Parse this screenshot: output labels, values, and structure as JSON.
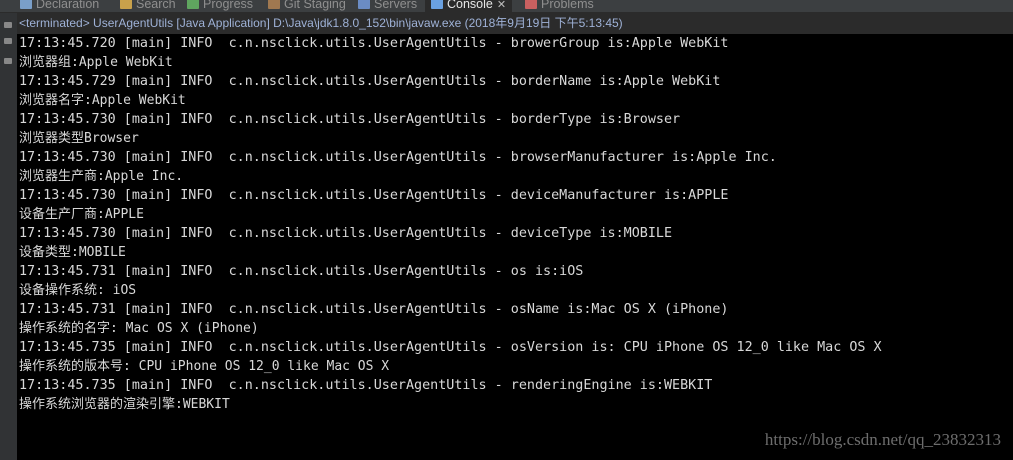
{
  "tabs": [
    {
      "name": "tab-declaration",
      "label": "Declaration",
      "icon": "declaration-icon",
      "color": "#7a9fc9"
    },
    {
      "name": "tab-search",
      "label": "Search",
      "icon": "search-icon",
      "color": "#c8a14b"
    },
    {
      "name": "tab-progress",
      "label": "Progress",
      "icon": "progress-icon",
      "color": "#5fa55f"
    },
    {
      "name": "tab-git-staging",
      "label": "Git Staging",
      "icon": "git-icon",
      "color": "#a07850"
    },
    {
      "name": "tab-servers",
      "label": "Servers",
      "icon": "servers-icon",
      "color": "#6b8cc4"
    },
    {
      "name": "tab-console",
      "label": "Console",
      "icon": "console-icon",
      "color": "#6aa0e0"
    },
    {
      "name": "tab-problems",
      "label": "Problems",
      "icon": "problems-icon",
      "color": "#c96060"
    }
  ],
  "console_tab_close": "✕",
  "status": "<terminated> UserAgentUtils [Java Application] D:\\Java\\jdk1.8.0_152\\bin\\javaw.exe (2018年9月19日 下午5:13:45)",
  "lines": [
    {
      "kind": "log",
      "text": "17:13:45.720 [main] INFO  c.n.nsclick.utils.UserAgentUtils - browerGroup is:Apple WebKit"
    },
    {
      "kind": "out",
      "text": "浏览器组:Apple WebKit"
    },
    {
      "kind": "log",
      "text": "17:13:45.729 [main] INFO  c.n.nsclick.utils.UserAgentUtils - borderName is:Apple WebKit"
    },
    {
      "kind": "out",
      "text": "浏览器名字:Apple WebKit"
    },
    {
      "kind": "log",
      "text": "17:13:45.730 [main] INFO  c.n.nsclick.utils.UserAgentUtils - borderType is:Browser"
    },
    {
      "kind": "out",
      "text": "浏览器类型Browser"
    },
    {
      "kind": "log",
      "text": "17:13:45.730 [main] INFO  c.n.nsclick.utils.UserAgentUtils - browserManufacturer is:Apple Inc."
    },
    {
      "kind": "out",
      "text": "浏览器生产商:Apple Inc."
    },
    {
      "kind": "log",
      "text": "17:13:45.730 [main] INFO  c.n.nsclick.utils.UserAgentUtils - deviceManufacturer is:APPLE"
    },
    {
      "kind": "out",
      "text": "设备生产厂商:APPLE"
    },
    {
      "kind": "log",
      "text": "17:13:45.730 [main] INFO  c.n.nsclick.utils.UserAgentUtils - deviceType is:MOBILE"
    },
    {
      "kind": "out",
      "text": "设备类型:MOBILE"
    },
    {
      "kind": "log",
      "text": "17:13:45.731 [main] INFO  c.n.nsclick.utils.UserAgentUtils - os is:iOS"
    },
    {
      "kind": "out",
      "text": "设备操作系统: iOS"
    },
    {
      "kind": "log",
      "text": "17:13:45.731 [main] INFO  c.n.nsclick.utils.UserAgentUtils - osName is:Mac OS X (iPhone)"
    },
    {
      "kind": "out",
      "text": "操作系统的名字: Mac OS X (iPhone)"
    },
    {
      "kind": "log",
      "text": "17:13:45.735 [main] INFO  c.n.nsclick.utils.UserAgentUtils - osVersion is: CPU iPhone OS 12_0 like Mac OS X"
    },
    {
      "kind": "out",
      "text": "操作系统的版本号: CPU iPhone OS 12_0 like Mac OS X"
    },
    {
      "kind": "log",
      "text": "17:13:45.735 [main] INFO  c.n.nsclick.utils.UserAgentUtils - renderingEngine is:WEBKIT"
    },
    {
      "kind": "out",
      "text": "操作系统浏览器的渲染引擎:WEBKIT"
    }
  ],
  "watermark": "https://blog.csdn.net/qq_23832313"
}
